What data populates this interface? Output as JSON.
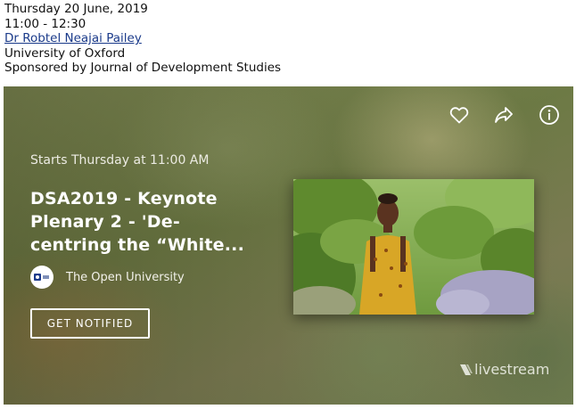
{
  "event": {
    "date": "Thursday 20 June, 2019",
    "time": "11:00 - 12:30",
    "speaker": "Dr Robtel Neajai Pailey",
    "affiliation": "University of Oxford",
    "sponsor": "Sponsored by Journal of Development Studies"
  },
  "card": {
    "starts_label": "Starts Thursday at 11:00 AM",
    "title_line1": "DSA2019 - Keynote",
    "title_line2": "Plenary 2 - 'De-",
    "title_line3": "centring the “White...",
    "org_name": "The Open University",
    "notify_label": "GET NOTIFIED",
    "brand_name": "livestream",
    "icons": [
      "heart-icon",
      "share-icon",
      "info-icon"
    ]
  }
}
